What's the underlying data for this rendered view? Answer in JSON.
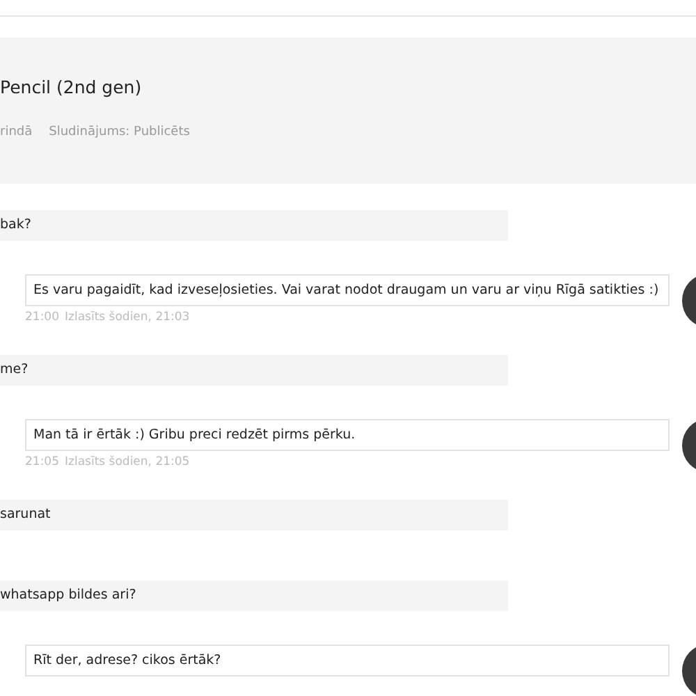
{
  "listing": {
    "title": "Pencil (2nd gen)",
    "meta": [
      "rindā",
      "Sludinājums: Publicēts"
    ]
  },
  "messages": [
    {
      "kind": "incoming",
      "text": "bak?"
    },
    {
      "kind": "outgoing",
      "text": "Es varu pagaidīt, kad izveseļosieties. Vai varat nodot draugam un varu ar viņu Rīgā satikties :)",
      "time": "21:00",
      "status": "Izlasīts šodien, 21:03"
    },
    {
      "kind": "incoming",
      "text": "me?"
    },
    {
      "kind": "outgoing",
      "text": "Man tā ir ērtāk :) Gribu preci redzēt pirms pērku.",
      "time": "21:05",
      "status": "Izlasīts šodien, 21:05"
    },
    {
      "kind": "incoming",
      "text": "sarunat"
    },
    {
      "kind": "incoming",
      "text": "whatsapp bildes ari?"
    },
    {
      "kind": "outgoing",
      "text": "Rīt der, adrese? cikos ērtāk?"
    }
  ]
}
